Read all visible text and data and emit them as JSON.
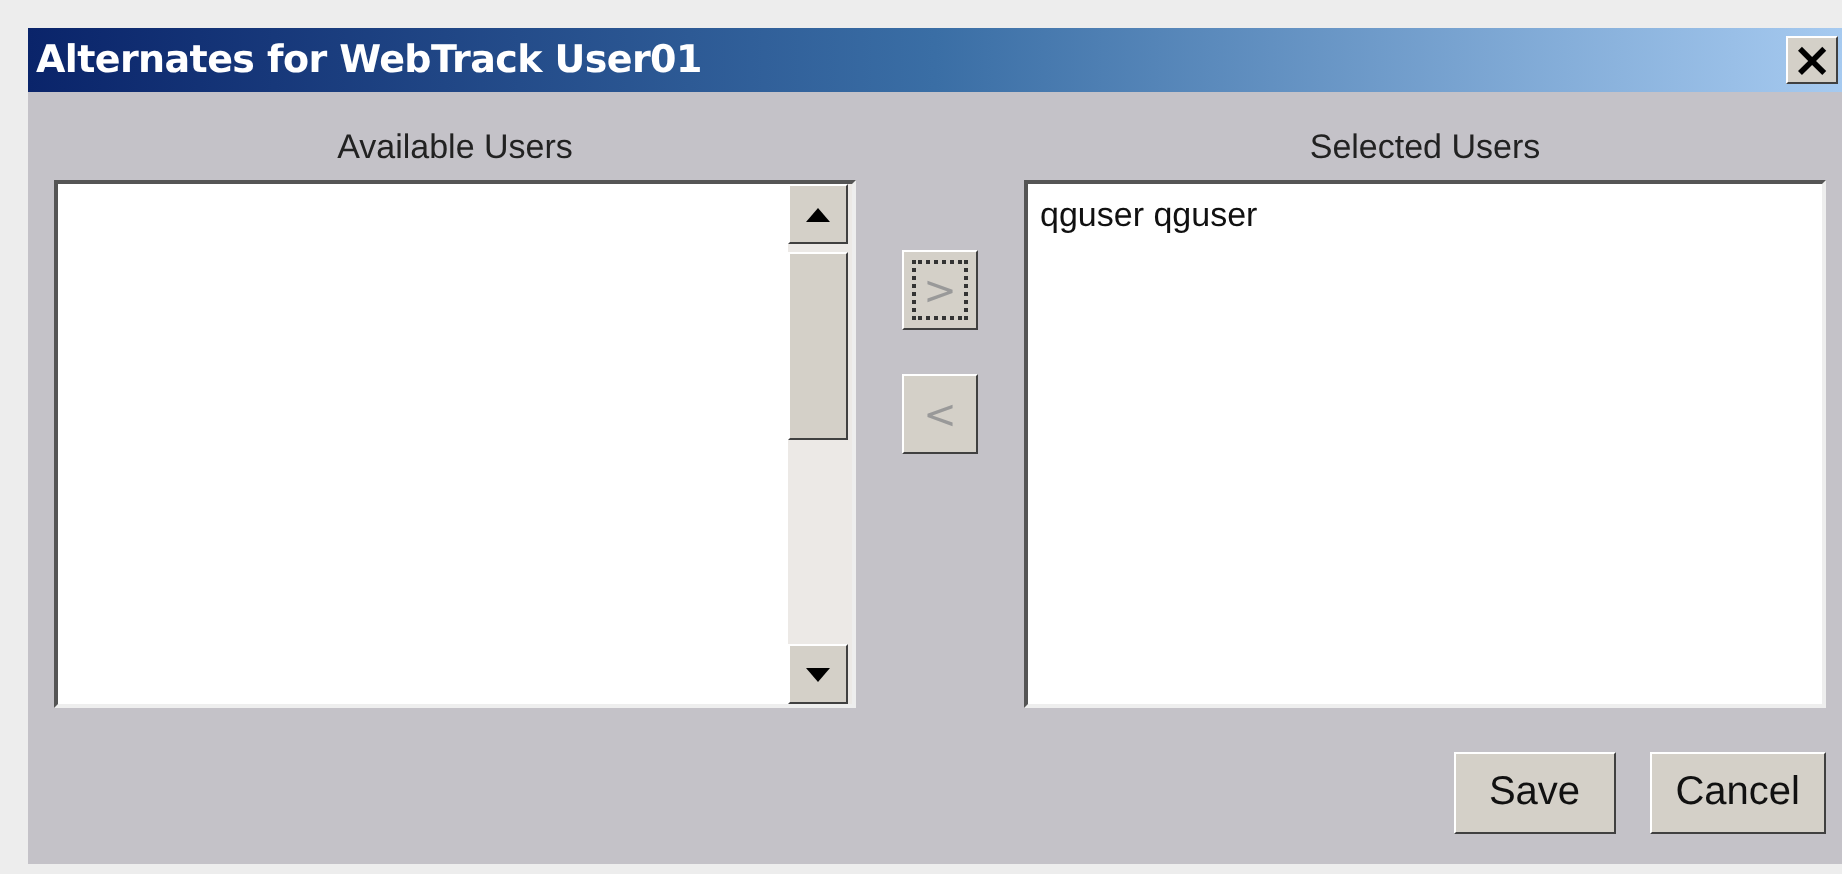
{
  "window": {
    "title": "Alternates for WebTrack User01",
    "close": "×"
  },
  "available": {
    "heading": "Available Users"
  },
  "transfer_buttons": [
    {
      "label": ">",
      "focused": true
    },
    {
      "label": "<",
      "focused": false
    }
  ],
  "selected": {
    "heading": "Selected Users",
    "items": [
      "qguser qguser"
    ]
  },
  "buttons": [
    "Save",
    "Cancel"
  ]
}
